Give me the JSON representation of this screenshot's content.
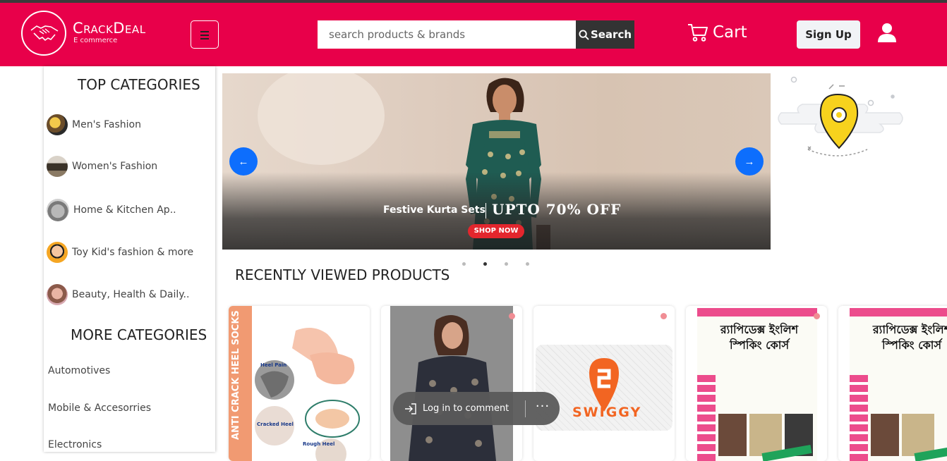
{
  "header": {
    "brand_name": "CrackDeal",
    "brand_tagline": "E commerce",
    "search_placeholder": "search products & brands",
    "search_button": "Search",
    "cart_label": "Cart",
    "signup_label": "Sign Up",
    "brand_color": "#e8004a"
  },
  "sidebar": {
    "top_heading": "TOP CATEGORIES",
    "top_items": [
      {
        "label": "Men's Fashion",
        "icon": "mens-fashion-thumbnail"
      },
      {
        "label": "Women's Fashion",
        "icon": "womens-fashion-thumbnail"
      },
      {
        "label": "Home & Kitchen Ap..",
        "icon": "home-kitchen-thumbnail"
      },
      {
        "label": "Toy Kid's fashion & more",
        "icon": "kids-thumbnail"
      },
      {
        "label": "Beauty, Health & Daily..",
        "icon": "beauty-thumbnail"
      }
    ],
    "more_heading": "MORE CATEGORIES",
    "more_items": [
      "Automotives",
      "Mobile & Accesorries",
      "Electronics"
    ]
  },
  "banner": {
    "caption": "Festive Kurta Sets",
    "offer": "UPTO 70% OFF",
    "cta": "SHOP NOW",
    "prev_icon": "arrow-left",
    "next_icon": "arrow-right",
    "slide_count": 4,
    "active_slide": 2
  },
  "recent": {
    "title": "RECENTLY VIEWED PRODUCTS",
    "products": [
      {
        "label": "ANTI CRACK HEEL SOCKS",
        "sub1": "Heel Pain",
        "sub2": "Cracked Heel",
        "sub3": "Rough Heel"
      },
      {
        "label": "",
        "sub1": "",
        "sub2": "",
        "sub3": ""
      },
      {
        "label": "SWIGGY",
        "sub1": "",
        "sub2": "",
        "sub3": ""
      },
      {
        "label": "র‍্যাপিডেক্স ইংলিশ স্পিকিং কোর্স",
        "sub1": "",
        "sub2": "",
        "sub3": ""
      },
      {
        "label": "র‍্যাপিডেক্স ইংলিশ স্পিকিং কোর্স",
        "sub1": "",
        "sub2": "",
        "sub3": ""
      }
    ]
  },
  "toast": {
    "login_label": "Log in to comment",
    "more_label": "···"
  }
}
